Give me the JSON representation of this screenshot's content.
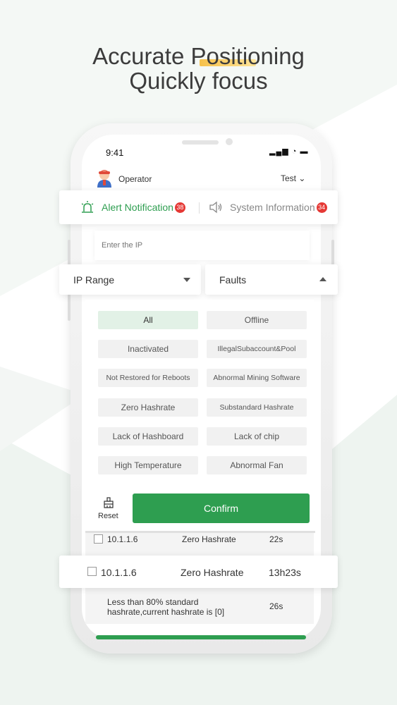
{
  "headline": {
    "line1": "Accurate Positioning",
    "line2": "Quickly focus"
  },
  "status_bar": {
    "time": "9:41",
    "icons": "▂▄▆ ◔ ▬"
  },
  "header": {
    "user": "Operator",
    "selector": "Test ⌄"
  },
  "tabs": [
    {
      "label": "Alert Notification",
      "badge": "38",
      "color": "#2e9e50"
    },
    {
      "label": "System Information",
      "badge": "34",
      "color": "#888888"
    }
  ],
  "search": {
    "placeholder": "Enter the IP"
  },
  "dropdowns": {
    "ip_range": "IP Range",
    "faults": "Faults"
  },
  "filters": [
    "All",
    "Offline",
    "Inactivated",
    "IllegalSubaccount&Pool",
    "Not Restored for Reboots",
    "Abnormal Mining Software",
    "Zero Hashrate",
    "Substandard Hashrate",
    "Lack of Hashboard",
    "Lack of chip",
    "High Temperature",
    "Abnormal Fan"
  ],
  "actions": {
    "reset": "Reset",
    "confirm": "Confirm"
  },
  "rows": [
    {
      "ip": "10.1.1.6",
      "fault": "Zero Hashrate",
      "time": "22s"
    },
    {
      "ip": "10.1.1.6",
      "fault": "Zero Hashrate",
      "time": "13h23s"
    },
    {
      "desc_line1": "Less than 80% standard",
      "desc_line2": "hashrate,current hashrate is [0]",
      "time": "26s"
    }
  ],
  "colors": {
    "accent": "#2e9e50",
    "badge": "#e53935",
    "chip_active": "#e2f1e6"
  }
}
